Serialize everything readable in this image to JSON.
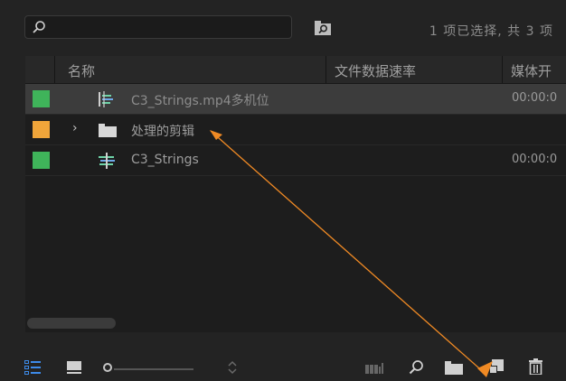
{
  "search": {
    "value": "",
    "placeholder": ""
  },
  "status": {
    "selection_text": "1 项已选择, 共 3 项"
  },
  "columns": [
    {
      "label": "名称"
    },
    {
      "label": "文件数据速率"
    },
    {
      "label": "媒体开"
    }
  ],
  "items": [
    {
      "name": "C3_Strings.mp4多机位",
      "time": "00:00:0",
      "label_color": "#3fb45a",
      "icon": "multicam-sequence-icon",
      "selected": true
    },
    {
      "name": "处理的剪辑",
      "time": "",
      "label_color": "#f0a53a",
      "icon": "folder-icon",
      "expand": "›",
      "selected": false
    },
    {
      "name": "C3_Strings",
      "time": "00:00:0",
      "label_color": "#3fb45a",
      "icon": "sequence-icon",
      "selected": false
    }
  ],
  "bottom_toolbar": {
    "icons": [
      "list-view-icon",
      "icon-view-icon",
      "zoom-slider",
      "sort-icon",
      "automate-to-sequence-icon",
      "find-icon",
      "new-bin-icon",
      "new-item-icon",
      "clear-icon"
    ]
  },
  "colors": {
    "accent_annotation": "#f08a24",
    "selected_row": "#3c3c3c",
    "list_view_active": "#3d8bea"
  }
}
